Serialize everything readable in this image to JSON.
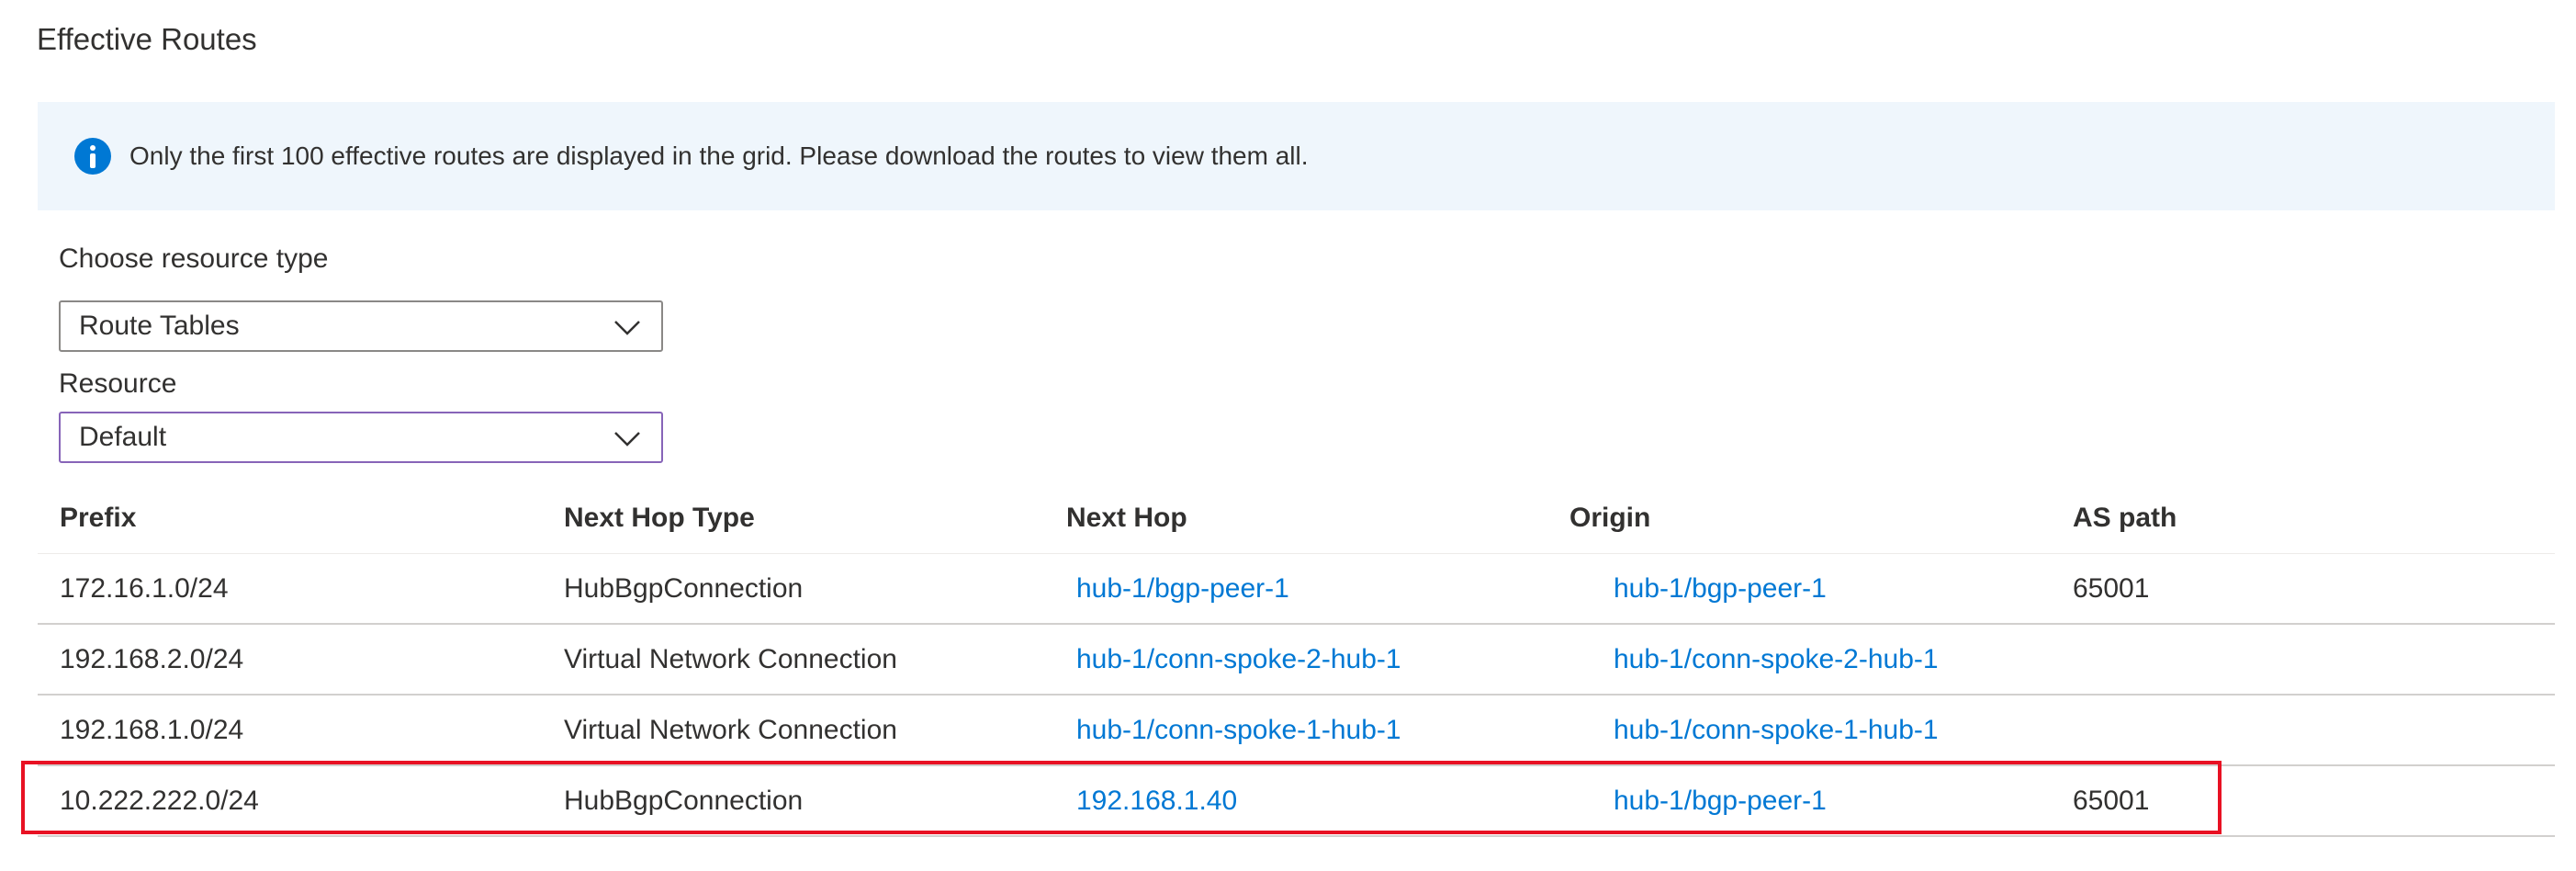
{
  "page_title": "Effective Routes",
  "banner": {
    "icon": "info-icon",
    "text": "Only the first 100 effective routes are displayed in the grid. Please download the routes to view them all."
  },
  "resource_type": {
    "label": "Choose resource type",
    "value": "Route Tables"
  },
  "resource": {
    "label": "Resource",
    "value": "Default"
  },
  "table": {
    "columns": [
      "Prefix",
      "Next Hop Type",
      "Next Hop",
      "Origin",
      "AS path"
    ],
    "rows": [
      {
        "prefix": "172.16.1.0/24",
        "next_hop_type": "HubBgpConnection",
        "next_hop": "hub-1/bgp-peer-1",
        "origin": "hub-1/bgp-peer-1",
        "as_path": "65001"
      },
      {
        "prefix": "192.168.2.0/24",
        "next_hop_type": "Virtual Network Connection",
        "next_hop": "hub-1/conn-spoke-2-hub-1",
        "origin": "hub-1/conn-spoke-2-hub-1",
        "as_path": ""
      },
      {
        "prefix": "192.168.1.0/24",
        "next_hop_type": "Virtual Network Connection",
        "next_hop": "hub-1/conn-spoke-1-hub-1",
        "origin": "hub-1/conn-spoke-1-hub-1",
        "as_path": ""
      },
      {
        "prefix": "10.222.222.0/24",
        "next_hop_type": "HubBgpConnection",
        "next_hop": "192.168.1.40",
        "origin": "hub-1/bgp-peer-1",
        "as_path": "65001"
      }
    ]
  },
  "colors": {
    "link": "#0078d4",
    "highlight": "#e81123",
    "banner_bg": "#eff6fc"
  }
}
